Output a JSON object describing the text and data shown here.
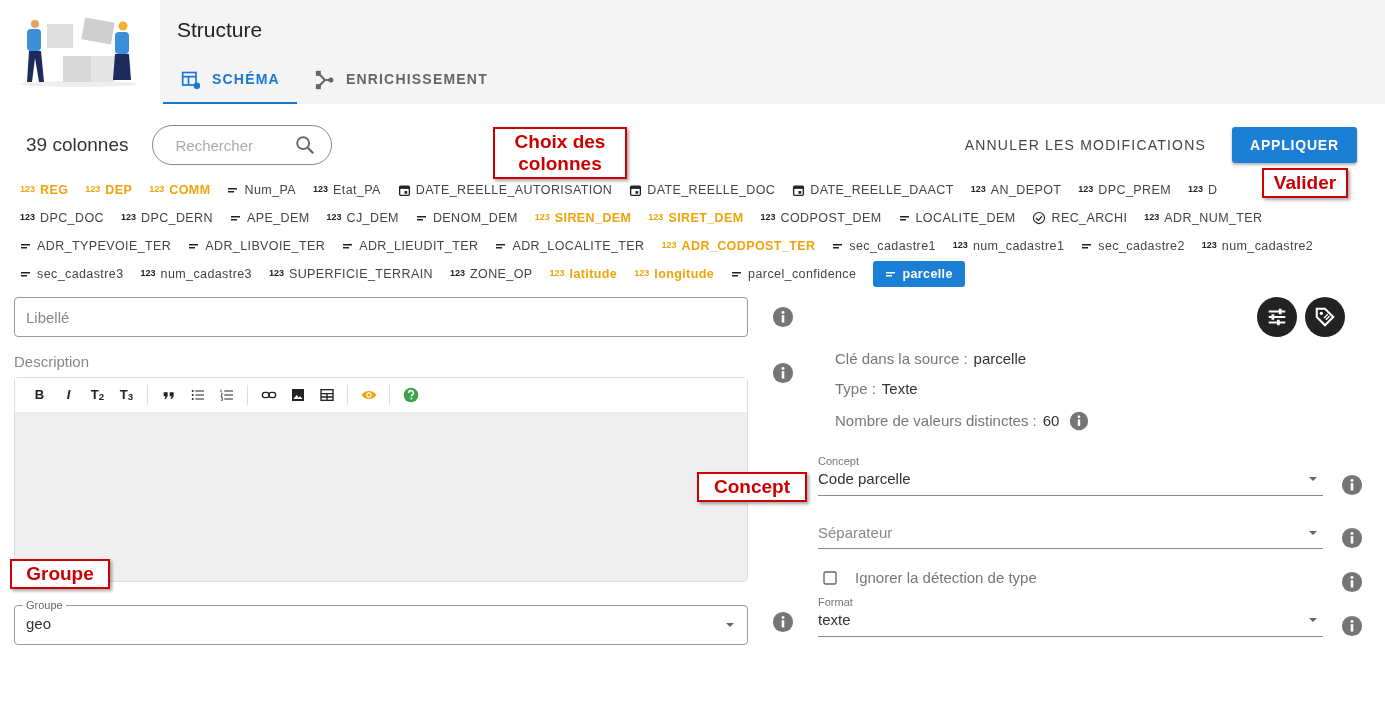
{
  "header": {
    "title": "Structure",
    "tabs": [
      {
        "label": "SCHÉMA",
        "kind": "schema",
        "selected": true
      },
      {
        "label": "ENRICHISSEMENT",
        "kind": "graph",
        "selected": false
      }
    ]
  },
  "toolbar": {
    "count": "39 colonnes",
    "search": {
      "placeholder": "Rechercher"
    },
    "cancel": "ANNULER LES MODIFICATIONS",
    "apply": "APPLIQUER"
  },
  "column_rows": [
    [
      {
        "name": "REG",
        "kind": "number",
        "glyph": "123",
        "highlighted": true,
        "selected": false
      },
      {
        "name": "DEP",
        "kind": "number",
        "glyph": "123",
        "highlighted": true,
        "selected": false
      },
      {
        "name": "COMM",
        "kind": "number",
        "glyph": "123",
        "highlighted": true,
        "selected": false
      },
      {
        "name": "Num_PA",
        "kind": "text",
        "highlighted": false,
        "selected": false
      },
      {
        "name": "Etat_PA",
        "kind": "number",
        "glyph": "123",
        "highlighted": false,
        "selected": false
      },
      {
        "name": "DATE_REELLE_AUTORISATION",
        "kind": "date",
        "highlighted": false,
        "selected": false
      },
      {
        "name": "DATE_REELLE_DOC",
        "kind": "date",
        "highlighted": false,
        "selected": false
      },
      {
        "name": "DATE_REELLE_DAACT",
        "kind": "date",
        "highlighted": false,
        "selected": false
      },
      {
        "name": "AN_DEPOT",
        "kind": "number",
        "glyph": "123",
        "highlighted": false,
        "selected": false
      },
      {
        "name": "DPC_PREM",
        "kind": "number",
        "glyph": "123",
        "highlighted": false,
        "selected": false
      },
      {
        "name": "D",
        "kind": "number",
        "glyph": "123",
        "highlighted": false,
        "selected": false
      }
    ],
    [
      {
        "name": "DPC_DOC",
        "kind": "number",
        "glyph": "123",
        "highlighted": false,
        "selected": false
      },
      {
        "name": "DPC_DERN",
        "kind": "number",
        "glyph": "123",
        "highlighted": false,
        "selected": false
      },
      {
        "name": "APE_DEM",
        "kind": "text",
        "highlighted": false,
        "selected": false
      },
      {
        "name": "CJ_DEM",
        "kind": "number",
        "glyph": "123",
        "highlighted": false,
        "selected": false
      },
      {
        "name": "DENOM_DEM",
        "kind": "text",
        "highlighted": false,
        "selected": false
      },
      {
        "name": "SIREN_DEM",
        "kind": "number",
        "glyph": "123",
        "highlighted": true,
        "selected": false
      },
      {
        "name": "SIRET_DEM",
        "kind": "number",
        "glyph": "123",
        "highlighted": true,
        "selected": false
      },
      {
        "name": "CODPOST_DEM",
        "kind": "number",
        "glyph": "123",
        "highlighted": false,
        "selected": false
      },
      {
        "name": "LOCALITE_DEM",
        "kind": "text",
        "highlighted": false,
        "selected": false
      },
      {
        "name": "REC_ARCHI",
        "kind": "boolean",
        "highlighted": false,
        "selected": false
      },
      {
        "name": "ADR_NUM_TER",
        "kind": "number",
        "glyph": "123",
        "highlighted": false,
        "selected": false
      }
    ],
    [
      {
        "name": "ADR_TYPEVOIE_TER",
        "kind": "text",
        "highlighted": false,
        "selected": false
      },
      {
        "name": "ADR_LIBVOIE_TER",
        "kind": "text",
        "highlighted": false,
        "selected": false
      },
      {
        "name": "ADR_LIEUDIT_TER",
        "kind": "text",
        "highlighted": false,
        "selected": false
      },
      {
        "name": "ADR_LOCALITE_TER",
        "kind": "text",
        "highlighted": false,
        "selected": false
      },
      {
        "name": "ADR_CODPOST_TER",
        "kind": "number",
        "glyph": "123",
        "highlighted": true,
        "selected": false
      },
      {
        "name": "sec_cadastre1",
        "kind": "text",
        "highlighted": false,
        "selected": false
      },
      {
        "name": "num_cadastre1",
        "kind": "number",
        "glyph": "123",
        "highlighted": false,
        "selected": false
      },
      {
        "name": "sec_cadastre2",
        "kind": "text",
        "highlighted": false,
        "selected": false
      },
      {
        "name": "num_cadastre2",
        "kind": "number",
        "glyph": "123",
        "highlighted": false,
        "selected": false
      }
    ],
    [
      {
        "name": "sec_cadastre3",
        "kind": "text",
        "highlighted": false,
        "selected": false
      },
      {
        "name": "num_cadastre3",
        "kind": "number",
        "glyph": "123",
        "highlighted": false,
        "selected": false
      },
      {
        "name": "SUPERFICIE_TERRAIN",
        "kind": "number",
        "glyph": "123",
        "highlighted": false,
        "selected": false
      },
      {
        "name": "ZONE_OP",
        "kind": "number",
        "glyph": "123",
        "highlighted": false,
        "selected": false
      },
      {
        "name": "latitude",
        "kind": "number",
        "glyph": "123",
        "highlighted": true,
        "selected": false
      },
      {
        "name": "longitude",
        "kind": "number",
        "glyph": "123",
        "highlighted": true,
        "selected": false
      },
      {
        "name": "parcel_confidence",
        "kind": "text",
        "highlighted": false,
        "selected": false
      },
      {
        "name": "parcelle",
        "kind": "text",
        "highlighted": false,
        "selected": true
      }
    ]
  ],
  "left_form": {
    "label_field": {
      "placeholder": "Libellé"
    },
    "description_label": "Description",
    "editor_toolbar": [
      [
        {
          "kind": "text",
          "label": "B"
        },
        {
          "kind": "text",
          "label": "I",
          "italic": true
        },
        {
          "kind": "text",
          "label": "T$_{2}$"
        },
        {
          "kind": "text",
          "label": "T$_{3}$"
        }
      ],
      [
        {
          "kind": "quote"
        },
        {
          "kind": "bullets"
        },
        {
          "kind": "numbered"
        }
      ],
      [
        {
          "kind": "link"
        },
        {
          "kind": "image"
        },
        {
          "kind": "table"
        }
      ],
      [
        {
          "kind": "eye"
        }
      ],
      [
        {
          "kind": "help"
        }
      ]
    ],
    "group": {
      "label": "Groupe",
      "value": "geo"
    }
  },
  "right_form": {
    "metadata": [
      {
        "label": "Clé dans la source :",
        "value": "parcelle",
        "info": false
      },
      {
        "label": "Type :",
        "value": "Texte",
        "info": false
      },
      {
        "label": "Nombre de valeurs distinctes :",
        "value": "60",
        "info": true
      }
    ],
    "concept": {
      "label": "Concept",
      "value": "Code parcelle"
    },
    "separator": {
      "placeholder": "Séparateur"
    },
    "ignore_type": {
      "label": "Ignorer la détection de type",
      "checked": false
    },
    "format": {
      "label": "Format",
      "value": "texte"
    }
  },
  "annotations": [
    {
      "text": "Choix des colonnes"
    },
    {
      "text": "Valider"
    },
    {
      "text": "Concept"
    },
    {
      "text": "Groupe"
    }
  ]
}
